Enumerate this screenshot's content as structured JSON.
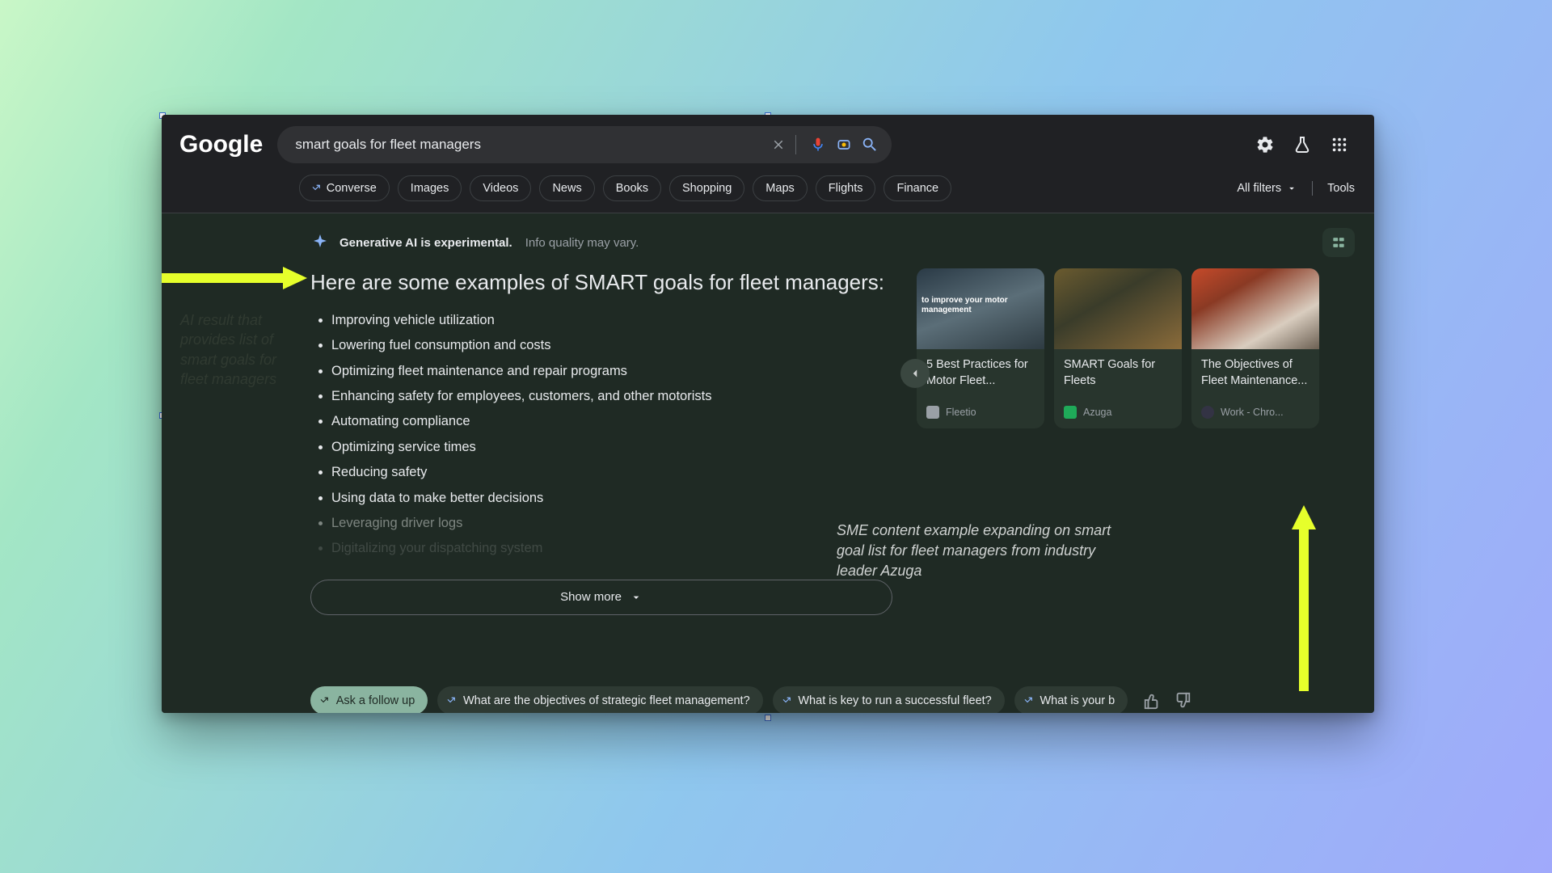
{
  "logo": "Google",
  "search": {
    "query": "smart goals for fleet managers"
  },
  "chips": {
    "converse": "Converse",
    "items": [
      "Images",
      "Videos",
      "News",
      "Books",
      "Shopping",
      "Maps",
      "Flights",
      "Finance"
    ],
    "all_filters": "All filters",
    "tools": "Tools"
  },
  "ai": {
    "disclaimer_bold": "Generative AI is experimental.",
    "disclaimer_sub": "Info quality may vary.",
    "heading": "Here are some examples of SMART goals for fleet managers:",
    "bullets": [
      "Improving vehicle utilization",
      "Lowering fuel consumption and costs",
      "Optimizing fleet maintenance and repair programs",
      "Enhancing safety for employees, customers, and other motorists",
      "Automating compliance",
      "Optimizing service times",
      "Reducing safety",
      "Using data to make better decisions"
    ],
    "bullets_faded": [
      "Leveraging driver logs",
      "Digitalizing your dispatching system"
    ],
    "show_more": "Show more"
  },
  "cards": [
    {
      "title": "5 Best Practices for Motor Fleet...",
      "source": "Fleetio"
    },
    {
      "title": "SMART Goals for Fleets",
      "source": "Azuga"
    },
    {
      "title": "The Objectives of Fleet Maintenance...",
      "source": "Work - Chro..."
    }
  ],
  "follow": {
    "primary": "Ask a follow up",
    "suggestions": [
      "What are the objectives of strategic fleet management?",
      "What is key to run a successful fleet?",
      "What is your b"
    ]
  },
  "annotations": {
    "left": "AI result that provides list of smart goals for fleet managers",
    "right": "SME content example expanding on smart goal list for fleet managers from industry leader Azuga"
  }
}
